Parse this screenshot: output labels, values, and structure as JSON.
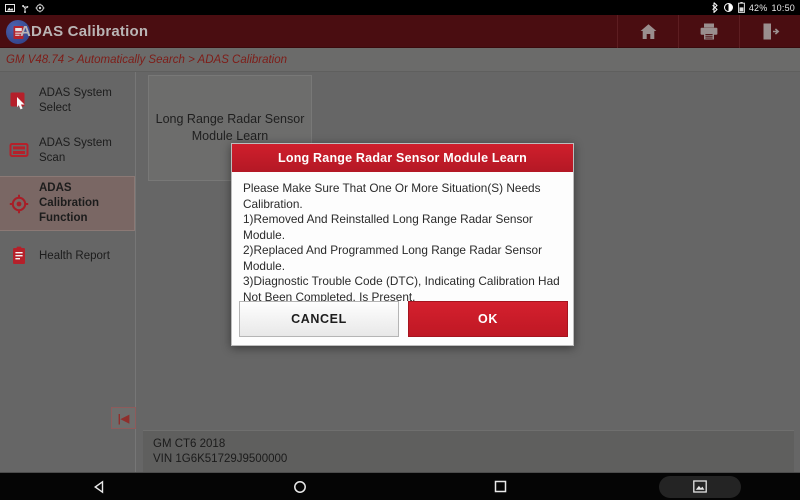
{
  "statusbar": {
    "icons_left": [
      "screenshot-icon",
      "usb-icon",
      "settings-icon"
    ],
    "bluetooth_icon": "bluetooth-icon",
    "brightness_icon": "brightness-icon",
    "battery_icon": "battery-icon",
    "battery_label": "42%",
    "clock": "10:50"
  },
  "header": {
    "title": "ADAS Calibration",
    "logo_icon": "app-logo-icon",
    "buttons": [
      {
        "name": "home-button",
        "icon": "home-icon"
      },
      {
        "name": "print-button",
        "icon": "printer-icon"
      },
      {
        "name": "exit-button",
        "icon": "exit-icon"
      }
    ]
  },
  "breadcrumb": {
    "text": "GM V48.74 > Automatically Search > ADAS Calibration"
  },
  "sidebar": {
    "collapse_label": "|◀",
    "items": [
      {
        "label": "ADAS System Select",
        "icon": "cursor-select-icon",
        "selected": false
      },
      {
        "label": "ADAS System Scan",
        "icon": "module-scan-icon",
        "selected": false
      },
      {
        "label": "ADAS Calibration Function",
        "icon": "target-calibration-icon",
        "selected": true
      },
      {
        "label": "Health Report",
        "icon": "clipboard-report-icon",
        "selected": false
      }
    ]
  },
  "content": {
    "function_card_label": "Long Range Radar Sensor Module Learn"
  },
  "vehicle": {
    "line1": "GM CT6 2018",
    "line2": "VIN 1G6K51729J9500000"
  },
  "dialog": {
    "title": "Long Range Radar Sensor Module Learn",
    "lines": [
      "Please Make Sure That One Or More Situation(S) Needs Calibration.",
      "1)Removed And Reinstalled Long Range Radar Sensor Module.",
      "2)Replaced And Programmed Long Range Radar Sensor Module.",
      "3)Diagnostic Trouble Code (DTC), Indicating Calibration Had Not Been Completed, Is Present."
    ],
    "cancel_label": "CANCEL",
    "ok_label": "OK"
  },
  "navbar": {
    "back_icon": "back-triangle-icon",
    "home_icon": "home-circle-icon",
    "recents_icon": "recents-square-icon",
    "screenshot_icon": "screenshot-icon"
  },
  "colors": {
    "header": "#4a0d11",
    "accent_red": "#cf1f2c",
    "breadcrumb_text": "#7e1d18",
    "page_bg": "#666666",
    "selected_item": "#7a6764"
  }
}
